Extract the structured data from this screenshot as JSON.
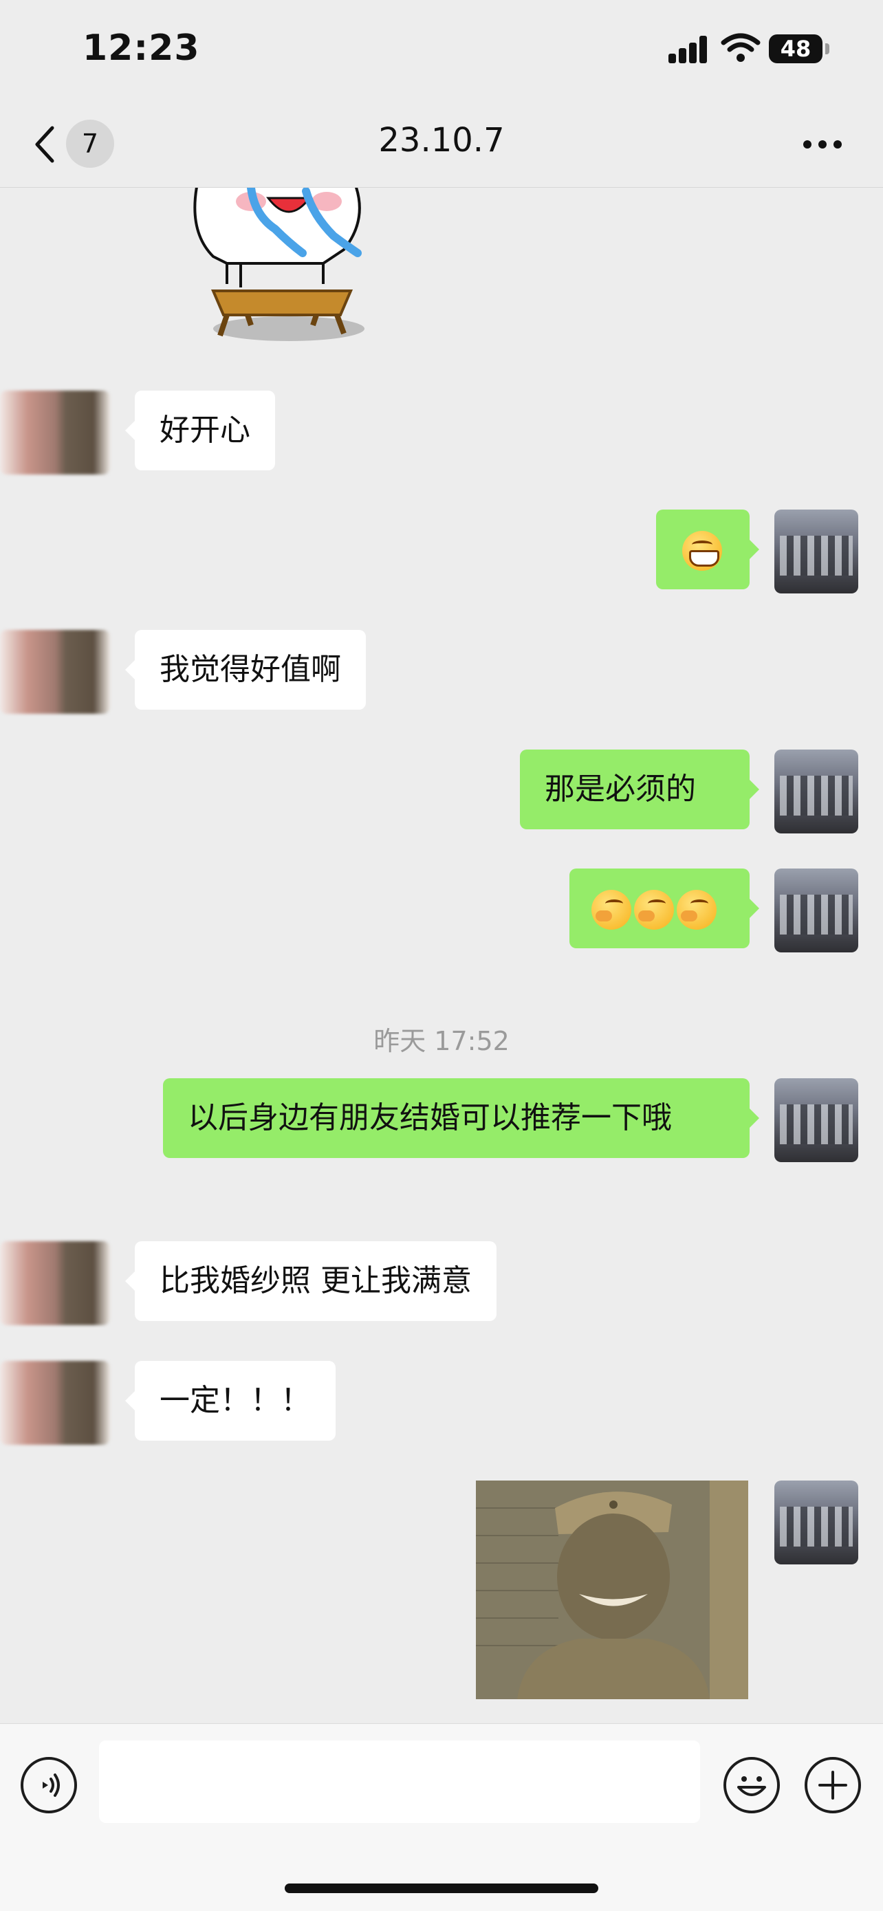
{
  "status_bar": {
    "time": "12:23",
    "battery": "48"
  },
  "nav": {
    "back_count": "7",
    "title": "23.10.7"
  },
  "messages": {
    "m1": "好开心",
    "m3": "我觉得好值啊",
    "m4": "那是必须的",
    "timestamp": "昨天 17:52",
    "m6": "以后身边有朋友结婚可以推荐一下哦",
    "m7": "比我婚纱照 更让我满意",
    "m8": "一定！！！"
  },
  "icons": {
    "back": "chevron-left-icon",
    "more": "more-dots-icon",
    "voice": "voice-icon",
    "emoji": "emoji-face-icon",
    "plus": "plus-icon"
  },
  "colors": {
    "background": "#ededed",
    "sent_bubble": "#95ec69",
    "received_bubble": "#ffffff"
  }
}
